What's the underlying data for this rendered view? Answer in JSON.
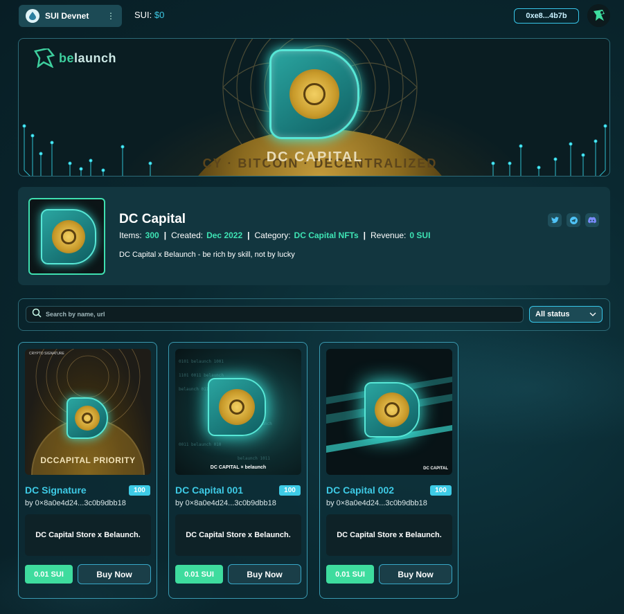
{
  "topbar": {
    "network_label": "SUI Devnet",
    "balance_label": "SUI:",
    "balance_value": "$0",
    "address": "0xe8...4b7b"
  },
  "banner": {
    "brand": "belaunch",
    "brand_prefix": "be",
    "brand_suffix": "launch",
    "coin_text": "CY · BITCOIN · DECENTRALIZED",
    "title": "DC CAPITAL"
  },
  "collection": {
    "name": "DC Capital",
    "items_label": "Items:",
    "items_value": "300",
    "created_label": "Created:",
    "created_value": "Dec 2022",
    "category_label": "Category:",
    "category_value": "DC Capital NFTs",
    "revenue_label": "Revenue:",
    "revenue_value": "0 SUI",
    "description": "DC Capital x Belaunch - be rich by skill, not by lucky",
    "social": [
      "twitter-icon",
      "telegram-icon",
      "discord-icon"
    ]
  },
  "filter": {
    "search_placeholder": "Search by name, url",
    "status_value": "All status"
  },
  "nfts": [
    {
      "name": "DC Signature",
      "count": "100",
      "creator": "by 0×8a0e4d24...3c0b9dbb18",
      "description": "DC Capital Store x Belaunch.",
      "price": "0.01 SUI",
      "buy_label": "Buy Now",
      "image_caption": "DCCAPITAL PRIORITY",
      "image_tag": "CRYPTO SIGNATURE"
    },
    {
      "name": "DC Capital 001",
      "count": "100",
      "creator": "by 0×8a0e4d24...3c0b9dbb18",
      "description": "DC Capital Store x Belaunch.",
      "price": "0.01 SUI",
      "buy_label": "Buy Now",
      "image_caption": "DC CAPITAL × belaunch"
    },
    {
      "name": "DC Capital 002",
      "count": "100",
      "creator": "by 0×8a0e4d24...3c0b9dbb18",
      "description": "DC Capital Store x Belaunch.",
      "price": "0.01 SUI",
      "buy_label": "Buy Now",
      "image_caption": "DC CAPITAL"
    }
  ],
  "colors": {
    "accent": "#3ecbe6",
    "green": "#3edc9e",
    "card_bg": "#12363f"
  }
}
